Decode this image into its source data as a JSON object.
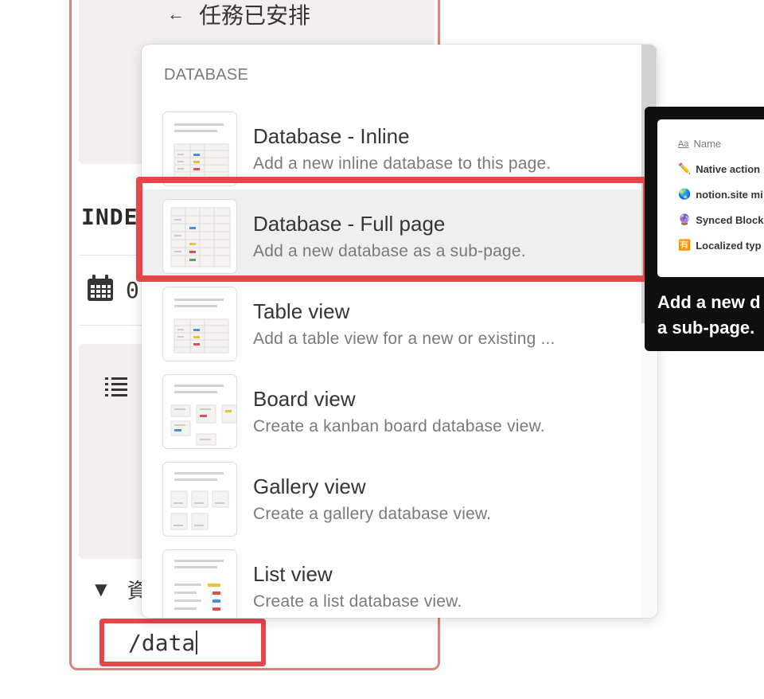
{
  "page": {
    "back_arrow": "←",
    "callout_title": "任務已安排",
    "index_heading": "INDE",
    "date_value": "0",
    "toggle_arrow": "▼",
    "toggle_label": "資"
  },
  "slash_input": {
    "value": "/data"
  },
  "menu": {
    "section_label": "DATABASE",
    "items": [
      {
        "title": "Database - Inline",
        "description": "Add a new inline database to this page.",
        "icon": "database-inline-icon"
      },
      {
        "title": "Database - Full page",
        "description": "Add a new database as a sub-page.",
        "icon": "database-full-page-icon",
        "selected": true
      },
      {
        "title": "Table view",
        "description": "Add a table view for a new or existing ...",
        "icon": "table-view-icon"
      },
      {
        "title": "Board view",
        "description": "Create a kanban board database view.",
        "icon": "board-view-icon"
      },
      {
        "title": "Gallery view",
        "description": "Create a gallery database view.",
        "icon": "gallery-view-icon"
      },
      {
        "title": "List view",
        "description": "Create a list database view.",
        "icon": "list-view-icon"
      }
    ]
  },
  "tooltip": {
    "column_prefix": "Aa",
    "column_header": "Name",
    "rows": [
      {
        "emoji": "✏️",
        "label": "Native action"
      },
      {
        "emoji": "🌏",
        "label": "notion.site mi"
      },
      {
        "emoji": "🔮",
        "label": "Synced Block"
      },
      {
        "emoji": "🈶",
        "label": "Localized typ"
      }
    ],
    "caption_line1": "Add a new d",
    "caption_line2": "a sub-page."
  },
  "colors": {
    "annotation_red": "#e8454b",
    "page_border": "#d9857a",
    "callout_bg": "#f3efee",
    "tag_blue": "#4a8fd9",
    "tag_yellow": "#e9c33d",
    "tag_red": "#e0504f",
    "tag_green": "#5aa55a"
  }
}
